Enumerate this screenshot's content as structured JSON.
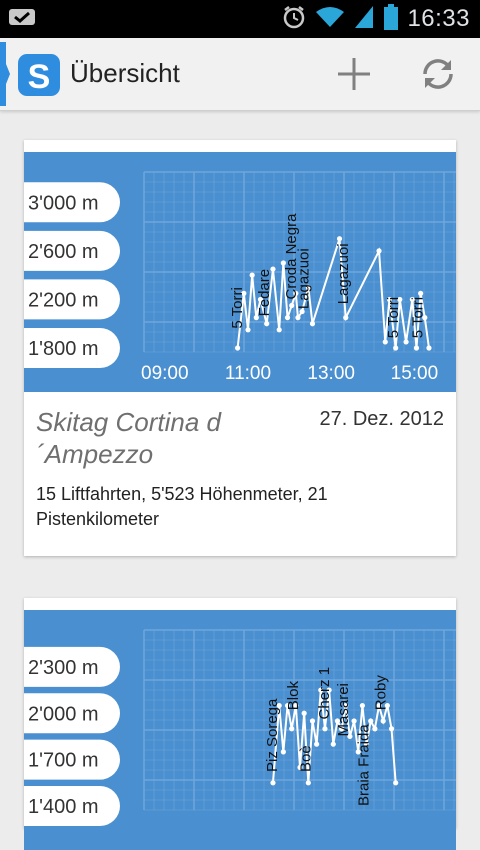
{
  "status_bar": {
    "time": "16:33",
    "icons": [
      "notification-icon",
      "alarm-icon",
      "wifi-icon",
      "signal-icon",
      "battery-icon"
    ]
  },
  "action_bar": {
    "logo_letter": "S",
    "title": "Übersicht",
    "actions": [
      "add-icon",
      "refresh-icon"
    ]
  },
  "colors": {
    "chart_bg": "#4a8fd0",
    "grid": "#6ea6dc",
    "logo": "#2f8de0"
  },
  "cards": [
    {
      "title": "Skitag Cortina d´Ampezzo",
      "date": "27. Dez. 2012",
      "summary": "15 Liftfahrten, 5'523 Höhenmeter, 21 Pistenkilometer"
    },
    {
      "title": "",
      "date": "",
      "summary": ""
    }
  ],
  "chart_data": [
    {
      "type": "line",
      "y_labels": [
        "3'000 m",
        "2'600 m",
        "2'200 m",
        "1'800 m"
      ],
      "y_ticks": [
        3000,
        2600,
        2200,
        1800
      ],
      "x_labels": [
        "09:00",
        "11:00",
        "13:00",
        "15:00"
      ],
      "x_ticks": [
        9,
        11,
        13,
        15
      ],
      "xlim": [
        8.5,
        16.0
      ],
      "ylim": [
        1800,
        3200
      ],
      "x": [
        10.75,
        10.9,
        11.0,
        11.1,
        11.2,
        11.3,
        11.45,
        11.6,
        11.75,
        11.85,
        11.95,
        12.05,
        12.15,
        12.2,
        12.3,
        12.45,
        12.55,
        13.2,
        13.35,
        14.15,
        14.3,
        14.4,
        14.55,
        14.65,
        14.8,
        14.95,
        15.05,
        15.15,
        15.25,
        15.35
      ],
      "y": [
        1800,
        2250,
        1950,
        2400,
        2050,
        2200,
        2000,
        2450,
        1950,
        2500,
        2050,
        2150,
        2250,
        2050,
        2100,
        2300,
        2000,
        2700,
        2050,
        2600,
        1850,
        2200,
        1800,
        2200,
        1850,
        2200,
        1800,
        2250,
        2050,
        1800
      ],
      "labels": [
        {
          "text": "5 Torri",
          "x": 10.85,
          "y": 1960
        },
        {
          "text": "Fedare",
          "x": 11.5,
          "y": 2060
        },
        {
          "text": "Croda Negra",
          "x": 12.15,
          "y": 2200
        },
        {
          "text": "Lagazuoi",
          "x": 12.45,
          "y": 2120
        },
        {
          "text": "Lagazuoi",
          "x": 13.4,
          "y": 2160
        },
        {
          "text": "5 Torri",
          "x": 14.6,
          "y": 1880
        },
        {
          "text": "5 Torri",
          "x": 15.2,
          "y": 1880
        }
      ]
    },
    {
      "type": "line",
      "y_labels": [
        "2'300 m",
        "2'000 m",
        "1'700 m",
        "1'400 m"
      ],
      "y_ticks": [
        2300,
        2000,
        1700,
        1400
      ],
      "x_labels": [],
      "x_ticks": [],
      "xlim": [
        8.5,
        16.0
      ],
      "ylim": [
        1400,
        2500
      ],
      "x": [
        11.6,
        11.75,
        11.85,
        11.95,
        12.05,
        12.15,
        12.25,
        12.35,
        12.45,
        12.55,
        12.65,
        12.75,
        12.85,
        12.95,
        13.05,
        13.15,
        13.25,
        13.35,
        13.45,
        13.55,
        13.65,
        13.75,
        13.85,
        13.95,
        14.05,
        14.15,
        14.25,
        14.35,
        14.45,
        14.55
      ],
      "y": [
        1550,
        2050,
        1750,
        2050,
        1900,
        2050,
        1650,
        2000,
        1550,
        1950,
        1800,
        2150,
        1900,
        2150,
        1800,
        1950,
        1900,
        2050,
        1850,
        1950,
        1750,
        2050,
        1800,
        1950,
        1900,
        2050,
        1950,
        2050,
        1900,
        1550
      ],
      "labels": [
        {
          "text": "Piz Sorega",
          "x": 11.7,
          "y": 1620
        },
        {
          "text": "Blok",
          "x": 12.2,
          "y": 2020
        },
        {
          "text": "Boè",
          "x": 12.5,
          "y": 1620
        },
        {
          "text": "Cherz 1",
          "x": 12.95,
          "y": 1960
        },
        {
          "text": "Masarei",
          "x": 13.4,
          "y": 1850
        },
        {
          "text": "Braia Fraida",
          "x": 13.9,
          "y": 1400
        },
        {
          "text": "Roby",
          "x": 14.3,
          "y": 2020
        }
      ]
    }
  ]
}
